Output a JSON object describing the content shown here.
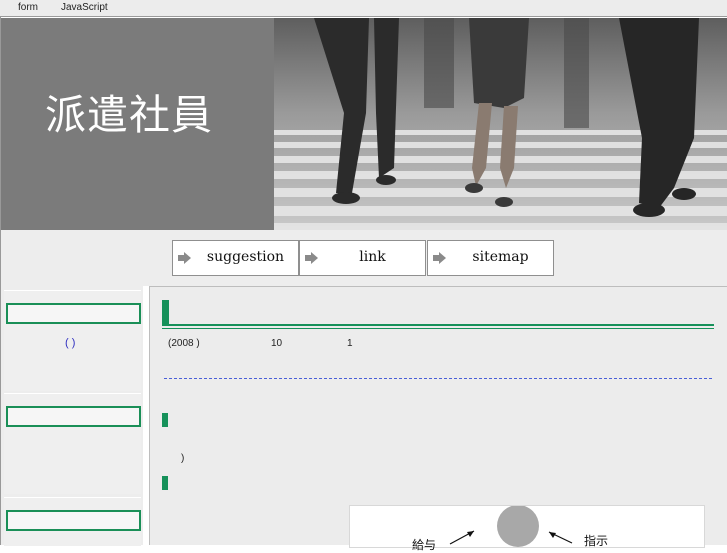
{
  "topbar": {
    "form": "form",
    "javascript": "JavaScript"
  },
  "header": {
    "title": "派遣社員"
  },
  "nav": [
    {
      "label": "suggestion"
    },
    {
      "label": "link"
    },
    {
      "label": "sitemap"
    }
  ],
  "sidebar": {
    "link_text": "(     )"
  },
  "main": {
    "year_text": "(2008 )",
    "month_text": "10",
    "day_text": "1",
    "paren_text": ")",
    "diagram": {
      "label_left": "給与",
      "label_right": "指示"
    }
  },
  "colors": {
    "accent_green": "#16915a",
    "header_gray": "#7b7b7b",
    "link_blue": "#3030c0"
  }
}
